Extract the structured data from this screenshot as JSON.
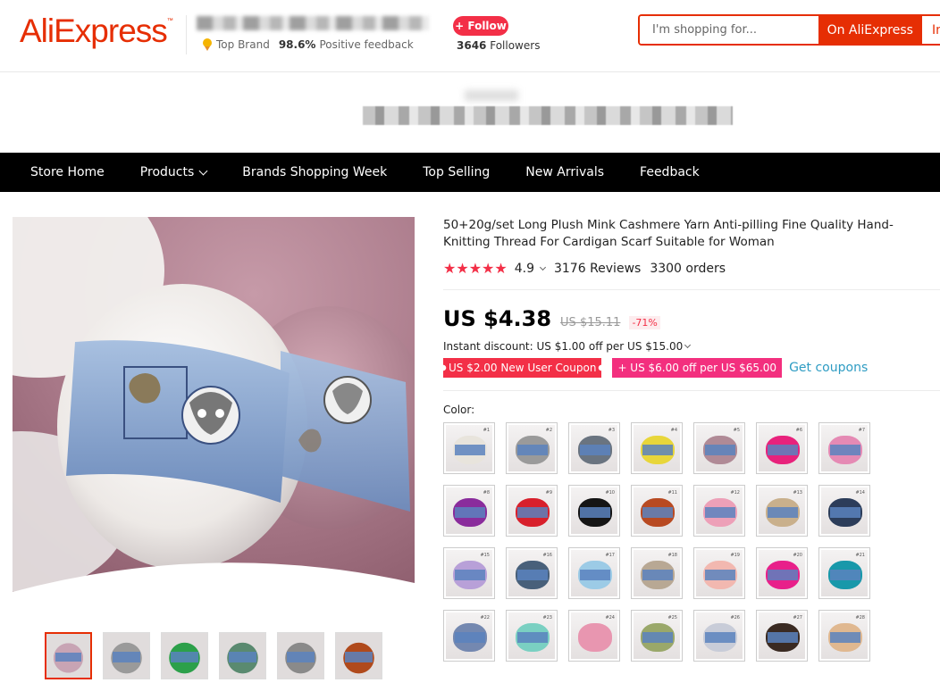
{
  "header": {
    "logo": "AliExpress",
    "top_brand": "Top Brand",
    "positive_pct": "98.6%",
    "positive_label": "Positive feedback",
    "follow_label": "+ Follow",
    "followers_count": "3646",
    "followers_label": "Followers",
    "search_placeholder": "I'm shopping for...",
    "search_btn_on": "On AliExpress",
    "search_btn_in": "In"
  },
  "nav": {
    "items": [
      "Store Home",
      "Products",
      "Brands Shopping Week",
      "Top Selling",
      "New Arrivals",
      "Feedback"
    ]
  },
  "product": {
    "title": "50+20g/set Long Plush Mink Cashmere Yarn Anti-pilling Fine Quality Hand-Knitting Thread For Cardigan Scarf Suitable for Woman",
    "rating": "4.9",
    "reviews": "3176 Reviews",
    "orders": "3300 orders",
    "price": "US $4.38",
    "old_price": "US $15.11",
    "discount": "-71%",
    "instant_discount": "Instant discount: US $1.00 off per US $15.00",
    "coupon1": "US $2.00 New User Coupon",
    "coupon2": "+ US $6.00 off per US $65.00",
    "get_coupons": "Get coupons",
    "color_label": "Color:"
  },
  "swatches": [
    {
      "color": "#e8e4dc",
      "band": true,
      "tag": "#1"
    },
    {
      "color": "#9a9a9a",
      "band": true,
      "tag": "#2"
    },
    {
      "color": "#6a7480",
      "band": true,
      "tag": "#3"
    },
    {
      "color": "#e8d63a",
      "band": true,
      "tag": "#4"
    },
    {
      "color": "#b08a96",
      "band": true,
      "tag": "#5"
    },
    {
      "color": "#e8227c",
      "band": true,
      "tag": "#6"
    },
    {
      "color": "#e58ab4",
      "band": true,
      "tag": "#7"
    },
    {
      "color": "#8a2c9c",
      "band": true,
      "tag": "#8"
    },
    {
      "color": "#d8202c",
      "band": true,
      "tag": "#9"
    },
    {
      "color": "#151515",
      "band": true,
      "tag": "#10"
    },
    {
      "color": "#b84a22",
      "band": true,
      "tag": "#11"
    },
    {
      "color": "#eda0b8",
      "band": true,
      "tag": "#12"
    },
    {
      "color": "#c9b08c",
      "band": true,
      "tag": "#13"
    },
    {
      "color": "#2c3d5a",
      "band": true,
      "tag": "#14"
    },
    {
      "color": "#b8a0d8",
      "band": true,
      "tag": "#15"
    },
    {
      "color": "#48607a",
      "band": true,
      "tag": "#16"
    },
    {
      "color": "#9ccbe6",
      "band": true,
      "tag": "#17"
    },
    {
      "color": "#b8a894",
      "band": true,
      "tag": "#18"
    },
    {
      "color": "#f2b8b0",
      "band": true,
      "tag": "#19"
    },
    {
      "color": "#e8208a",
      "band": true,
      "tag": "#20"
    },
    {
      "color": "#1898aa",
      "band": true,
      "tag": "#21"
    },
    {
      "color": "#7488b0",
      "band": true,
      "tag": "#22"
    },
    {
      "color": "#7ad0c2",
      "band": true,
      "tag": "#23"
    },
    {
      "color": "#e896b0",
      "band": false,
      "tag": "#24"
    },
    {
      "color": "#9aa86a",
      "band": true,
      "tag": "#25"
    },
    {
      "color": "#c8ccd8",
      "band": true,
      "tag": "#26"
    },
    {
      "color": "#3a2a22",
      "band": true,
      "tag": "#27"
    },
    {
      "color": "#e0b890",
      "band": true,
      "tag": "#28"
    }
  ],
  "thumbnails": [
    {
      "color": "#c8a4b4"
    },
    {
      "color": "#9a9a9a"
    },
    {
      "color": "#2ca04a"
    },
    {
      "color": "#5a8a70"
    },
    {
      "color": "#8a8a8a"
    },
    {
      "color": "#b04a1c"
    }
  ],
  "colors": {
    "accent": "#e62e04",
    "follow": "#f32f47",
    "coupon_pink": "#f32f7e",
    "link": "#2e9cc3"
  }
}
